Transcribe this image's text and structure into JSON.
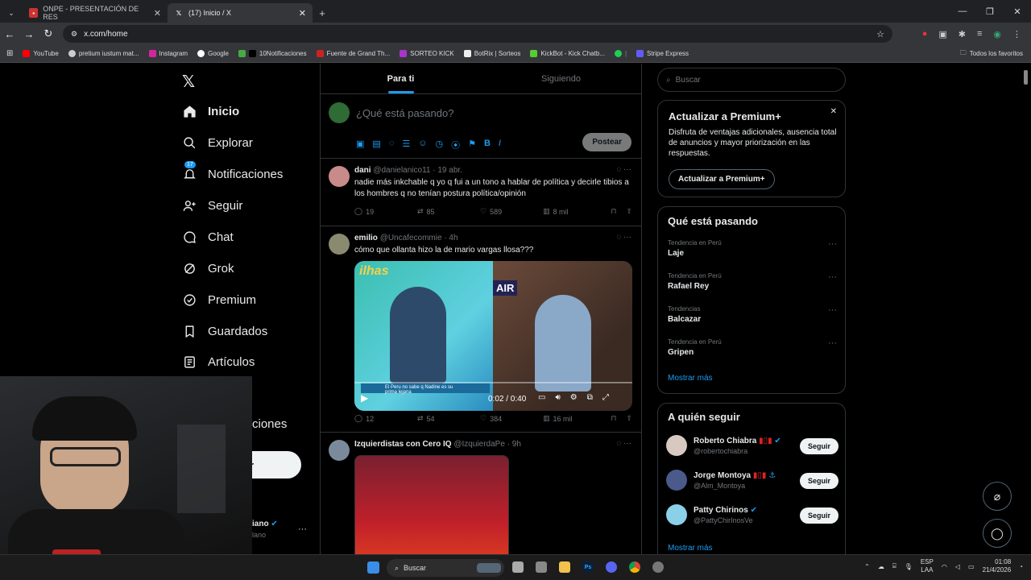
{
  "browser": {
    "tabs": [
      {
        "title": "ONPE - PRESENTACIÓN DE RES"
      },
      {
        "title": "(17) Inicio / X"
      }
    ],
    "url": "x.com/home",
    "bookmarks": [
      "YouTube",
      "pretium iustum mat...",
      "Instagram",
      "Google",
      "10Notificaciones",
      "Fuente de Grand Th...",
      "SORTEO KICK",
      "BotRix | Sorteos",
      "KickBot - Kick Chatb...",
      "Stripe Express"
    ],
    "all_bookmarks": "Todos los favoritos"
  },
  "sidebar": {
    "logo": "X",
    "items": [
      {
        "label": "Inicio",
        "icon": "home-icon"
      },
      {
        "label": "Explorar",
        "icon": "search-icon"
      },
      {
        "label": "Notificaciones",
        "icon": "bell-icon",
        "badge": "17"
      },
      {
        "label": "Seguir",
        "icon": "add-user-icon"
      },
      {
        "label": "Chat",
        "icon": "chat-icon"
      },
      {
        "label": "Grok",
        "icon": "grok-icon"
      },
      {
        "label": "Premium",
        "icon": "premium-icon"
      },
      {
        "label": "Guardados",
        "icon": "bookmark-icon"
      },
      {
        "label": "Artículos",
        "icon": "article-icon"
      }
    ],
    "partial_more": "ciones",
    "partial_post_btn": "r",
    "partial_user_name": "iano",
    "partial_user_handle": "lano",
    "user_more": "···"
  },
  "feed": {
    "tabs": [
      "Para ti",
      "Siguiendo"
    ],
    "compose_placeholder": "¿Qué está pasando?",
    "post_button": "Postear",
    "posts": [
      {
        "name": "dani",
        "handle": "@danielanico11",
        "time": "· 19 abr.",
        "text": "nadie más inkchable q yo q fui a un tono a hablar de política y decirle tibios a los hombres q no tenían postura política/opinión",
        "replies": "19",
        "reposts": "85",
        "likes": "589",
        "views": "8 mil"
      },
      {
        "name": "emilio",
        "handle": "@Uncafecommie",
        "time": "· 4h",
        "text": "cómo que ollanta hizo la de mario vargas llosa???",
        "video_time": "0:02 / 0:40",
        "video_caption": "El Peru no sabe q Nadine es su prima lejana",
        "video_overlay_left": "ilhas",
        "video_overlay_right": "AIR",
        "replies": "12",
        "reposts": "54",
        "likes": "384",
        "views": "16 mil"
      },
      {
        "name": "Izquierdistas con Cero IQ",
        "handle": "@IzquierdaPe",
        "time": "· 9h"
      }
    ]
  },
  "right": {
    "search_placeholder": "Buscar",
    "premium": {
      "title": "Actualizar a Premium+",
      "body": "Disfruta de ventajas adicionales, ausencia total de anuncios y mayor priorización en las respuestas.",
      "button": "Actualizar a Premium+"
    },
    "trends": {
      "title": "Qué está pasando",
      "items": [
        {
          "cat": "Tendencia en Perú",
          "name": "Laje"
        },
        {
          "cat": "Tendencia en Perú",
          "name": "Rafael Rey"
        },
        {
          "cat": "Tendencias",
          "name": "Balcazar"
        },
        {
          "cat": "Tendencia en Perú",
          "name": "Gripen"
        }
      ],
      "more": "Mostrar más"
    },
    "follow": {
      "title": "A quién seguir",
      "items": [
        {
          "name": "Roberto Chiabra",
          "handle": "@robertochiabra",
          "btn": "Seguir"
        },
        {
          "name": "Jorge Montoya",
          "handle": "@Alm_Montoya",
          "btn": "Seguir"
        },
        {
          "name": "Patty Chirinos",
          "handle": "@PattyChirInosVe",
          "btn": "Seguir"
        }
      ],
      "more": "Mostrar más"
    }
  },
  "taskbar": {
    "search": "Buscar",
    "lang": "ESP",
    "lang2": "LAA",
    "time": "01:08",
    "date": "21/4/2026"
  },
  "colors": {
    "accent": "#1d9bf0",
    "bg": "#000000",
    "border": "#2f3336",
    "muted": "#71767b"
  }
}
